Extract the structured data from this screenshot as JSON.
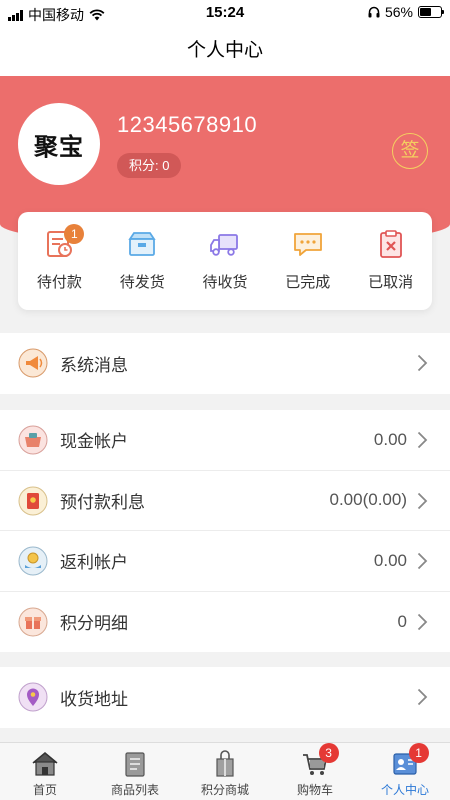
{
  "status_bar": {
    "carrier": "中国移动",
    "time": "15:24",
    "battery": "56%",
    "battery_level": 0.56
  },
  "nav": {
    "title": "个人中心"
  },
  "profile": {
    "avatar_text": "聚宝",
    "phone": "12345678910",
    "points_label": "积分: 0",
    "sign_label": "签"
  },
  "orders": [
    {
      "label": "待付款",
      "icon": "pending-payment-icon",
      "badge": "1"
    },
    {
      "label": "待发货",
      "icon": "pending-shipment-icon"
    },
    {
      "label": "待收货",
      "icon": "delivery-truck-icon"
    },
    {
      "label": "已完成",
      "icon": "completed-chat-icon"
    },
    {
      "label": "已取消",
      "icon": "cancelled-clipboard-icon"
    }
  ],
  "menu": {
    "messages": {
      "label": "系统消息",
      "icon": "megaphone-icon"
    },
    "cash": {
      "label": "现金帐户",
      "value": "0.00",
      "icon": "cash-account-icon"
    },
    "prepaid": {
      "label": "预付款利息",
      "value": "0.00(0.00)",
      "icon": "prepaid-envelope-icon"
    },
    "rebate": {
      "label": "返利帐户",
      "value": "0.00",
      "icon": "rebate-coin-icon"
    },
    "points": {
      "label": "积分明细",
      "value": "0",
      "icon": "gift-box-icon"
    },
    "address": {
      "label": "收货地址",
      "icon": "location-pin-icon"
    }
  },
  "tabs": [
    {
      "label": "首页",
      "icon": "home-icon"
    },
    {
      "label": "商品列表",
      "icon": "product-list-icon"
    },
    {
      "label": "积分商城",
      "icon": "points-mall-icon"
    },
    {
      "label": "购物车",
      "icon": "shopping-cart-icon",
      "badge": "3"
    },
    {
      "label": "个人中心",
      "icon": "profile-icon",
      "badge": "1",
      "active": true
    }
  ],
  "colors": {
    "header": "#ec6e6c",
    "badge_orange": "#e8813a",
    "badge_red": "#e53935",
    "active_tab": "#2b78d6",
    "sign_gold": "#f4d060"
  }
}
